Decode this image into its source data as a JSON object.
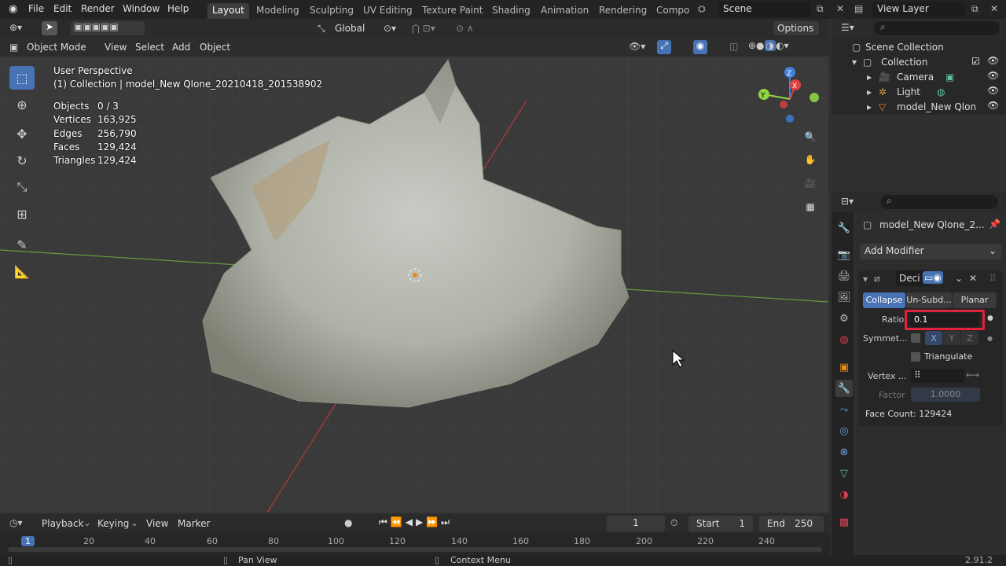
{
  "menu": {
    "file": "File",
    "edit": "Edit",
    "render": "Render",
    "window": "Window",
    "help": "Help"
  },
  "workspaces": [
    "Layout",
    "Modeling",
    "Sculpting",
    "UV Editing",
    "Texture Paint",
    "Shading",
    "Animation",
    "Rendering",
    "Compo"
  ],
  "scene": {
    "name": "Scene",
    "view_layer": "View Layer"
  },
  "header": {
    "orientation": "Global",
    "options": "Options",
    "mode": "Object Mode",
    "view": "View",
    "select": "Select",
    "add": "Add",
    "object": "Object"
  },
  "viewport": {
    "perspective": "User Perspective",
    "collection_label": "(1) Collection | model_New Qlone_20210418_201538902",
    "stats": [
      {
        "label": "Objects",
        "value": "0 / 3"
      },
      {
        "label": "Vertices",
        "value": "163,925"
      },
      {
        "label": "Edges",
        "value": "256,790"
      },
      {
        "label": "Faces",
        "value": "129,424"
      },
      {
        "label": "Triangles",
        "value": "129,424"
      }
    ]
  },
  "outliner": {
    "scene_collection": "Scene Collection",
    "collection": "Collection",
    "items": [
      "Camera",
      "Light",
      "model_New Qlon"
    ]
  },
  "properties": {
    "object_name": "model_New Qlone_2...",
    "add_modifier": "Add Modifier",
    "modifier_name": "Deci",
    "modes": [
      "Collapse",
      "Un-Subd...",
      "Planar"
    ],
    "ratio_label": "Ratio",
    "ratio_value": "0.1",
    "symmetry_label": "Symmet...",
    "axes": [
      "X",
      "Y",
      "Z"
    ],
    "triangulate": "Triangulate",
    "vertex_label": "Vertex ...",
    "factor_label": "Factor",
    "factor_value": "1.0000",
    "face_count": "Face Count: 129424"
  },
  "timeline": {
    "playback": "Playback",
    "keying": "Keying",
    "view": "View",
    "marker": "Marker",
    "current_frame": "1",
    "start_label": "Start",
    "start": "1",
    "end_label": "End",
    "end": "250",
    "ruler": [
      "1",
      "20",
      "40",
      "60",
      "80",
      "100",
      "120",
      "140",
      "160",
      "180",
      "200",
      "220",
      "240"
    ]
  },
  "status": {
    "pan": "Pan View",
    "context": "Context Menu",
    "version": "2.91.2"
  },
  "colors": {
    "accent": "#4772b3",
    "highlight": "#e0223c",
    "x_axis": "#e04040",
    "y_axis": "#8fd642",
    "z_axis": "#3f7fe0"
  }
}
